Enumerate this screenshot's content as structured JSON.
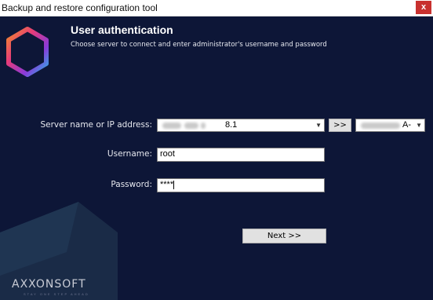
{
  "window": {
    "title": "Backup and restore configuration tool",
    "close_symbol": "x"
  },
  "header": {
    "title": "User authentication",
    "subtitle": "Choose server to connect and enter administrator's username and password"
  },
  "form": {
    "server_label": "Server name or IP address:",
    "server_value_suffix": "8.1",
    "browse_label": ">>",
    "node_value_suffix": "A-",
    "username_label": "Username:",
    "username_value": "root",
    "password_label": "Password:",
    "password_value": "****"
  },
  "footer": {
    "next_label": "Next >>",
    "brand": "AXXONSOFT",
    "tagline": "STAY ONE STEP AHEAD"
  }
}
